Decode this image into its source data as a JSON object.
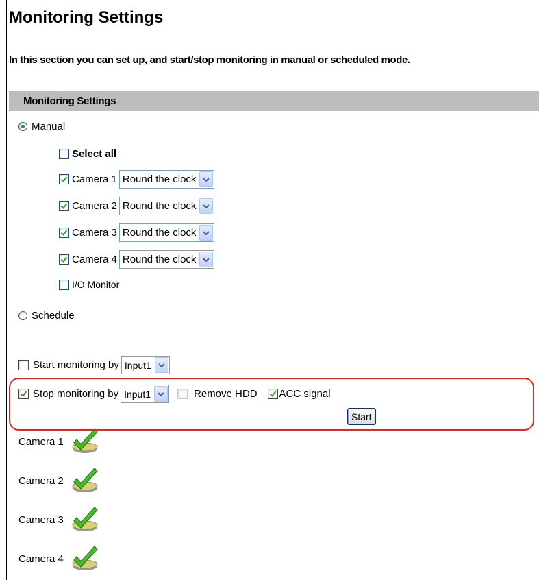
{
  "page": {
    "title": "Monitoring Settings",
    "intro": "In this section you can set up, and start/stop monitoring in manual or scheduled mode."
  },
  "section": {
    "header": "Monitoring Settings"
  },
  "mode": {
    "manual_label": "Manual",
    "manual_selected": true,
    "schedule_label": "Schedule",
    "schedule_selected": false
  },
  "manual": {
    "select_all_label": "Select all",
    "select_all_checked": false,
    "cameras": [
      {
        "label": "Camera 1",
        "checked": true,
        "mode": "Round the clock"
      },
      {
        "label": "Camera 2",
        "checked": true,
        "mode": "Round the clock"
      },
      {
        "label": "Camera 3",
        "checked": true,
        "mode": "Round the clock"
      },
      {
        "label": "Camera 4",
        "checked": true,
        "mode": "Round the clock"
      }
    ],
    "io_monitor_label": "I/O Monitor",
    "io_monitor_checked": false
  },
  "start_by": {
    "label": "Start monitoring by",
    "checked": false,
    "input": "Input1"
  },
  "stop_by": {
    "label": "Stop monitoring by",
    "checked": true,
    "input": "Input1",
    "remove_hdd_label": "Remove HDD",
    "remove_hdd_checked": false,
    "acc_label": "ACC signal",
    "acc_checked": true,
    "start_button": "Start"
  },
  "status": [
    {
      "label": "Camera 1",
      "icon": "green-checkmark-icon"
    },
    {
      "label": "Camera 2",
      "icon": "green-checkmark-icon"
    },
    {
      "label": "Camera 3",
      "icon": "green-checkmark-icon"
    },
    {
      "label": "Camera 4",
      "icon": "green-checkmark-icon"
    }
  ],
  "colors": {
    "header_bg": "#bdbdbd",
    "highlight_border": "#e2261e",
    "check_green": "#3a9a2a"
  }
}
